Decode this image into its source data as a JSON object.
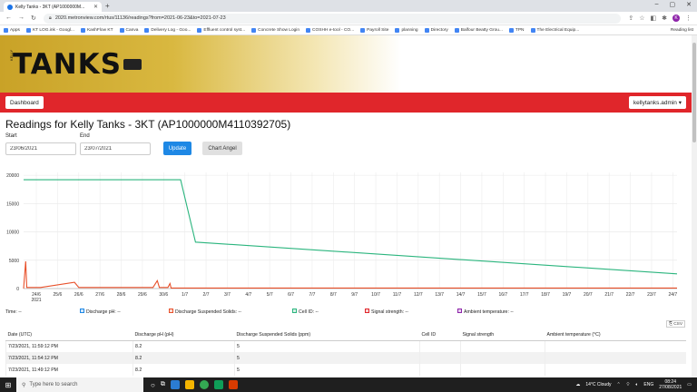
{
  "browser": {
    "tab_title": "Kelly Tanks - 3KT (AP1000000M...",
    "url": "2020.metronview.com/rtus/11136/readings?from=2021-06-23&to=2021-07-23",
    "profile_initial": "K"
  },
  "bookmarks": [
    "Apps",
    "KT LOG.ink - Googl...",
    "KashFlow KT",
    "Canva",
    "Delivery Log - Goo...",
    "Effluent control syst...",
    "Concrete Show Login",
    "COSHH e-tool - CO...",
    "Payroll Site",
    "planning",
    "Directory",
    "Balfour Beatty Grou...",
    "TPN",
    "The Electrical Equip..."
  ],
  "bookmarks_right": "Reading list",
  "site": {
    "logo_text": "TANKS",
    "logo_sub": "KELLY",
    "dashboard_label": "Dashboard",
    "user_label": "kellytanks.admin ▾"
  },
  "page": {
    "title": "Readings for Kelly Tanks - 3KT (AP1000000M4110392705)",
    "start_label": "Start",
    "end_label": "End",
    "start_value": "23/06/2021",
    "end_value": "23/07/2021",
    "update_label": "Update",
    "chart_angel_label": "Chart Angel"
  },
  "chart_data": {
    "type": "line",
    "x_ticks": [
      "24/6\n2021",
      "25/6",
      "26/6",
      "27/6",
      "28/6",
      "29/6",
      "30/6",
      "1/7",
      "2/7",
      "3/7",
      "4/7",
      "5/7",
      "6/7",
      "7/7",
      "8/7",
      "9/7",
      "10/7",
      "11/7",
      "12/7",
      "13/7",
      "14/7",
      "15/7",
      "16/7",
      "17/7",
      "18/7",
      "19/7",
      "20/7",
      "21/7",
      "22/7",
      "23/7",
      "24/7"
    ],
    "y_ticks": [
      0,
      5000,
      10000,
      15000,
      20000
    ],
    "ylim": [
      0,
      20500
    ],
    "xlim_days": [
      -0.6,
      30.2
    ],
    "grid": true,
    "series": [
      {
        "color": "#2bb57e",
        "points": [
          [
            -0.6,
            19200
          ],
          [
            6.8,
            19200
          ],
          [
            7.5,
            8200
          ],
          [
            30.2,
            2600
          ]
        ]
      },
      {
        "color": "#e8502a",
        "points": [
          [
            -0.6,
            0
          ],
          [
            -0.5,
            4800
          ],
          [
            -0.45,
            200
          ],
          [
            0.2,
            200
          ],
          [
            1.8,
            1100
          ],
          [
            2.0,
            200
          ],
          [
            5.5,
            200
          ],
          [
            5.7,
            1400
          ],
          [
            5.8,
            200
          ],
          [
            6.2,
            200
          ],
          [
            6.3,
            900
          ],
          [
            6.35,
            100
          ],
          [
            30.2,
            100
          ]
        ]
      }
    ]
  },
  "legend": {
    "time": "Time: --",
    "discharge_ph": "Discharge pH: --",
    "discharge_ss": "Discharge Suspended Solids: --",
    "cell_id": "Cell ID: --",
    "signal": "Signal strength: --",
    "ambient": "Ambient temperature: --",
    "colors": {
      "ph": "#1e88e5",
      "ss": "#e8502a",
      "cell": "#2bb57e",
      "signal": "#e0262b",
      "ambient": "#8e24aa"
    }
  },
  "csv_label": "CSV",
  "table": {
    "headers": [
      "Date (UTC)",
      "Discharge pH (pH)",
      "Discharge Suspended Solids (ppm)",
      "Cell ID",
      "Signal strength",
      "Ambient temperature (°C)"
    ],
    "rows": [
      [
        "7/23/2021, 11:59:12 PM",
        "8.2",
        "5",
        "",
        "",
        ""
      ],
      [
        "7/23/2021, 11:54:12 PM",
        "8.2",
        "5",
        "",
        "",
        ""
      ],
      [
        "7/23/2021, 11:49:12 PM",
        "8.2",
        "5",
        "",
        "",
        ""
      ]
    ]
  },
  "taskbar": {
    "search_placeholder": "Type here to search",
    "weather": "14°C  Cloudy",
    "lang": "ENG",
    "time": "08:24",
    "date": "27/08/2021"
  }
}
